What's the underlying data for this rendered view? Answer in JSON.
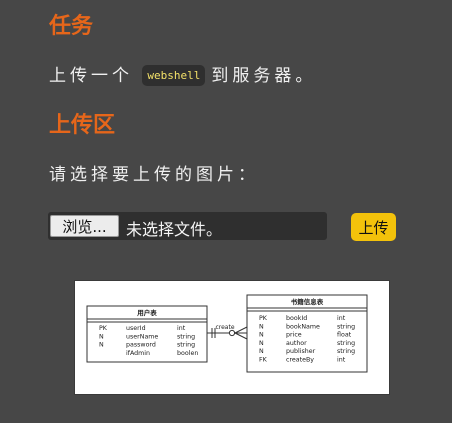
{
  "task": {
    "heading": "任务",
    "text_before": "上传一个",
    "code": "webshell",
    "text_after": "到服务器。"
  },
  "upload": {
    "heading": "上传区",
    "prompt": "请选择要上传的图片：",
    "browse_label": "浏览...",
    "file_status": "未选择文件。",
    "submit_label": "上传"
  },
  "diagram": {
    "relation_label": "create",
    "entity_left": {
      "title": "用户表",
      "keys": [
        "PK",
        "N",
        "N"
      ],
      "names": [
        "userId",
        "userName",
        "password",
        "ifAdmin"
      ],
      "types": [
        "int",
        "string",
        "string",
        "boolen"
      ]
    },
    "entity_right": {
      "title": "书籍信息表",
      "keys": [
        "PK",
        "N",
        "N",
        "N",
        "N",
        "FK"
      ],
      "names": [
        "bookId",
        "bookName",
        "price",
        "author",
        "publisher",
        "createBy"
      ],
      "types": [
        "int",
        "string",
        "float",
        "string",
        "string",
        "int"
      ]
    }
  }
}
